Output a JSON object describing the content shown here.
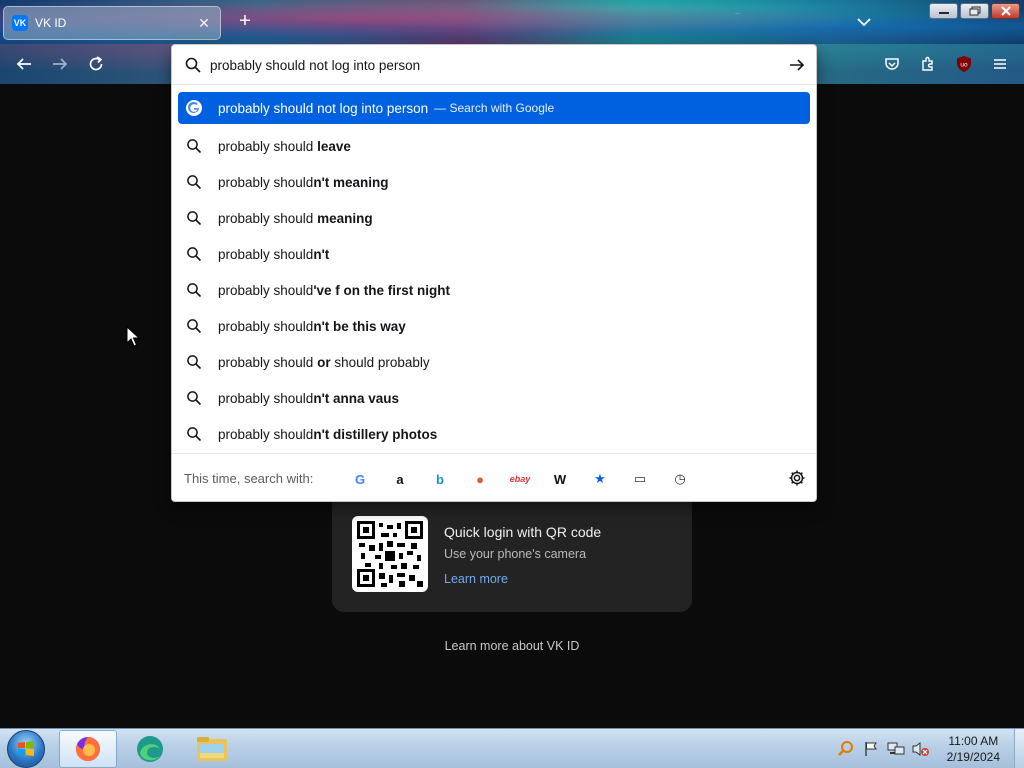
{
  "browser": {
    "tab": {
      "favicon": "VK",
      "title": "VK ID",
      "close_icon": "close-icon"
    },
    "new_tab_icon": "plus-icon",
    "tab_list_icon": "chevron-down-icon",
    "window_controls": [
      "minimize-icon",
      "restore-icon",
      "close-icon"
    ]
  },
  "toolbar": {
    "back_icon": "back-arrow-icon",
    "forward_icon": "forward-arrow-icon",
    "reload_icon": "reload-icon",
    "right_icons": [
      "pocket-icon",
      "extensions-icon",
      "ublock-shield-icon",
      "menu-icon"
    ]
  },
  "urlbar": {
    "value": "probably should not log into person",
    "go_icon": "arrow-right-icon"
  },
  "suggestions": [
    {
      "prefix": "probably should not log into person",
      "bold": "",
      "tail": "",
      "action": "— Search with Google",
      "selected": true
    },
    {
      "prefix": "probably should ",
      "bold": "leave",
      "tail": ""
    },
    {
      "prefix": "probably should",
      "bold": "n't meaning",
      "tail": ""
    },
    {
      "prefix": "probably should ",
      "bold": "meaning",
      "tail": ""
    },
    {
      "prefix": "probably should",
      "bold": "n't",
      "tail": ""
    },
    {
      "prefix": "probably should",
      "bold": "'ve f on the first night",
      "tail": ""
    },
    {
      "prefix": "probably should",
      "bold": "n't be this way",
      "tail": ""
    },
    {
      "prefix": "probably should ",
      "bold": "or",
      "tail": " should probably"
    },
    {
      "prefix": "probably should",
      "bold": "n't anna vaus",
      "tail": ""
    },
    {
      "prefix": "probably should",
      "bold": "n't distillery photos",
      "tail": ""
    }
  ],
  "oneoff": {
    "label": "This time, search with:",
    "engines": [
      {
        "name": "google-icon",
        "glyph": "G",
        "color": "#4285f4"
      },
      {
        "name": "amazon-icon",
        "glyph": "a",
        "color": "#111111"
      },
      {
        "name": "bing-icon",
        "glyph": "b",
        "color": "#1b8fd6"
      },
      {
        "name": "duckduckgo-icon",
        "glyph": "●",
        "color": "#de5833"
      },
      {
        "name": "ebay-icon",
        "glyph": "ebay",
        "color": "#e53238"
      },
      {
        "name": "wikipedia-icon",
        "glyph": "W",
        "color": "#111111"
      },
      {
        "name": "bookmarks-star-icon",
        "glyph": "★",
        "color": "#0061e0"
      },
      {
        "name": "tabs-icon",
        "glyph": "▭",
        "color": "#333333"
      },
      {
        "name": "history-clock-icon",
        "glyph": "◷",
        "color": "#333333"
      }
    ],
    "settings_icon": "gear-icon"
  },
  "page": {
    "qr_title": "Quick login with QR code",
    "qr_subtitle": "Use your phone's camera",
    "qr_link": "Learn more",
    "about_link": "Learn more about VK ID"
  },
  "taskbar": {
    "apps": [
      "firefox-icon",
      "edge-icon",
      "file-explorer-icon"
    ],
    "tray_icons": [
      "search-icon",
      "flag-icon",
      "network-icon",
      "volume-muted-icon"
    ],
    "time": "11:00 AM",
    "date": "2/19/2024"
  }
}
